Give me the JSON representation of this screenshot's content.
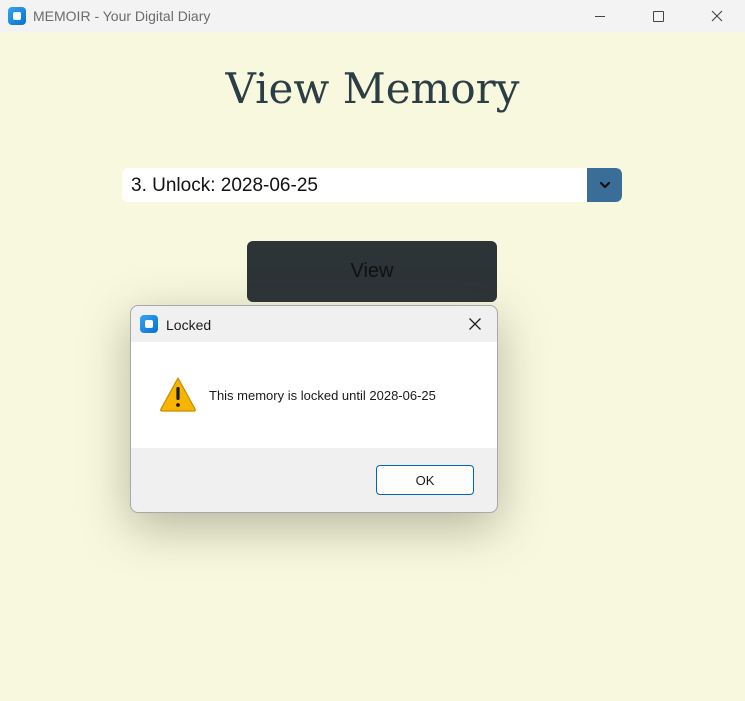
{
  "window": {
    "title": "MEMOIR - Your Digital Diary",
    "icon": "app-icon",
    "controls": [
      "minimize-icon",
      "maximize-icon",
      "close-icon"
    ]
  },
  "main": {
    "heading": "View Memory",
    "memory_select": {
      "selected_value": "3. Unlock: 2028-06-25",
      "dropdown_icon": "chevron-down-icon"
    },
    "view_button_label": "View"
  },
  "dialog": {
    "title": "Locked",
    "icon": "warning-icon",
    "message": "This memory is locked until 2028-06-25",
    "ok_label": "OK"
  },
  "colors": {
    "background": "#f8f8de",
    "heading": "#2c3e45",
    "dropdown_button": "#3a6e98",
    "view_button": "#2d3438",
    "ok_border": "#0067c0",
    "warning": "#f7b500"
  }
}
